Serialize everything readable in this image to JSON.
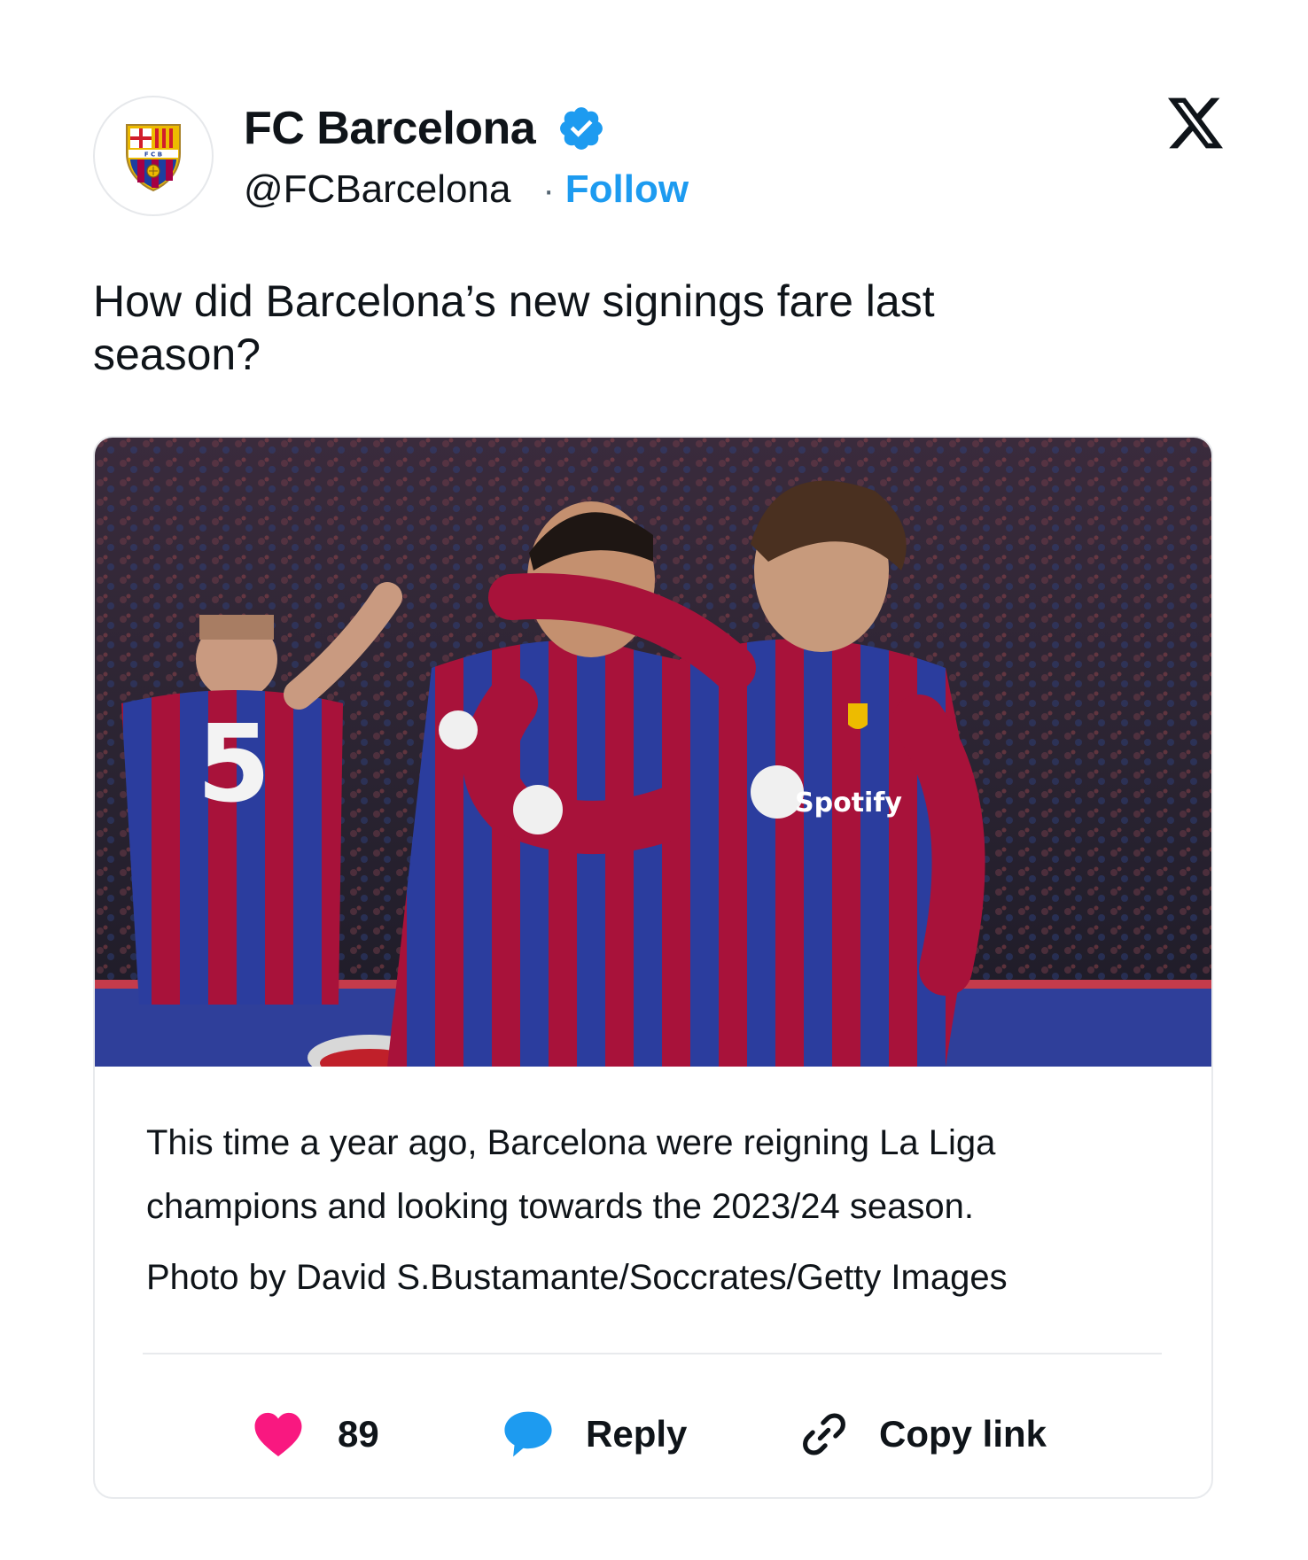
{
  "account": {
    "display_name": "FC Barcelona",
    "handle": "@FCBarcelona",
    "separator": "·",
    "follow_label": "Follow",
    "verified": true,
    "avatar_icon": "fc-barcelona-crest-icon"
  },
  "tweet": {
    "text": "How did Barcelona’s new signings fare last season?"
  },
  "card": {
    "image_icon": "players-celebrating-photo",
    "caption": "This time a year ago, Barcelona were reigning La Liga champions and looking towards the 2023/24 season.",
    "credit": "Photo by David S.Bustamante/Soccrates/Getty Images"
  },
  "actions": {
    "likes_count": "89",
    "reply_label": "Reply",
    "copy_label": "Copy link"
  },
  "colors": {
    "accent": "#1d9bf0",
    "like": "#f91880",
    "text": "#0f1419",
    "barca_blue": "#1c3fa0",
    "barca_red": "#a50044"
  }
}
